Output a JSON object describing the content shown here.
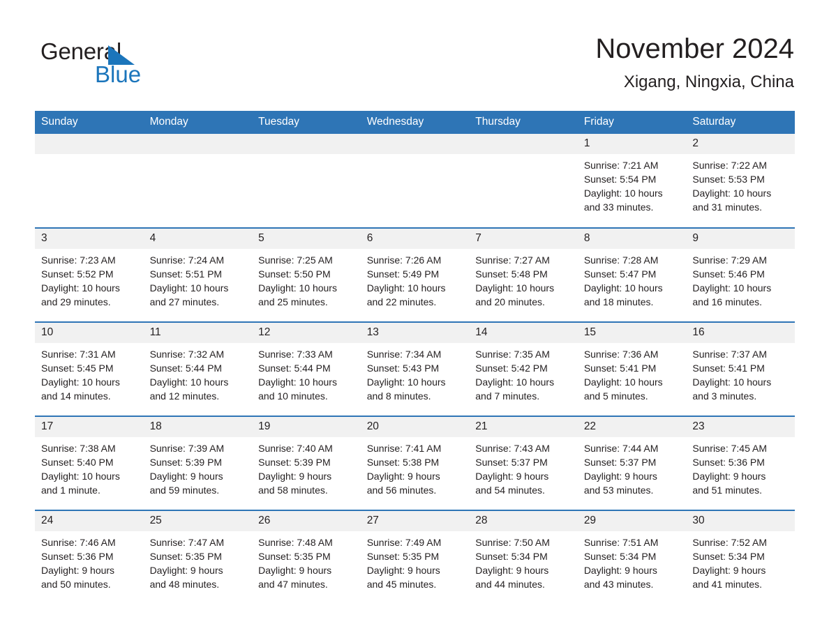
{
  "brand": {
    "name_part1": "General",
    "name_part2": "Blue",
    "triangle_icon": "triangle-icon",
    "accent_color": "#1b75bb"
  },
  "header": {
    "title": "November 2024",
    "location": "Xigang, Ningxia, China"
  },
  "theme": {
    "header_bg": "#2e75b6",
    "header_text": "#ffffff",
    "daynum_bg": "#f1f1f1",
    "body_text": "#231f20",
    "cell_border": "#2e75b6"
  },
  "calendar": {
    "weekday_headers": [
      "Sunday",
      "Monday",
      "Tuesday",
      "Wednesday",
      "Thursday",
      "Friday",
      "Saturday"
    ],
    "weeks": [
      [
        {
          "day": "",
          "info": "",
          "empty": true
        },
        {
          "day": "",
          "info": "",
          "empty": true
        },
        {
          "day": "",
          "info": "",
          "empty": true
        },
        {
          "day": "",
          "info": "",
          "empty": true
        },
        {
          "day": "",
          "info": "",
          "empty": true
        },
        {
          "day": "1",
          "info": "Sunrise: 7:21 AM\nSunset: 5:54 PM\nDaylight: 10 hours\nand 33 minutes.",
          "empty": false
        },
        {
          "day": "2",
          "info": "Sunrise: 7:22 AM\nSunset: 5:53 PM\nDaylight: 10 hours\nand 31 minutes.",
          "empty": false
        }
      ],
      [
        {
          "day": "3",
          "info": "Sunrise: 7:23 AM\nSunset: 5:52 PM\nDaylight: 10 hours\nand 29 minutes.",
          "empty": false
        },
        {
          "day": "4",
          "info": "Sunrise: 7:24 AM\nSunset: 5:51 PM\nDaylight: 10 hours\nand 27 minutes.",
          "empty": false
        },
        {
          "day": "5",
          "info": "Sunrise: 7:25 AM\nSunset: 5:50 PM\nDaylight: 10 hours\nand 25 minutes.",
          "empty": false
        },
        {
          "day": "6",
          "info": "Sunrise: 7:26 AM\nSunset: 5:49 PM\nDaylight: 10 hours\nand 22 minutes.",
          "empty": false
        },
        {
          "day": "7",
          "info": "Sunrise: 7:27 AM\nSunset: 5:48 PM\nDaylight: 10 hours\nand 20 minutes.",
          "empty": false
        },
        {
          "day": "8",
          "info": "Sunrise: 7:28 AM\nSunset: 5:47 PM\nDaylight: 10 hours\nand 18 minutes.",
          "empty": false
        },
        {
          "day": "9",
          "info": "Sunrise: 7:29 AM\nSunset: 5:46 PM\nDaylight: 10 hours\nand 16 minutes.",
          "empty": false
        }
      ],
      [
        {
          "day": "10",
          "info": "Sunrise: 7:31 AM\nSunset: 5:45 PM\nDaylight: 10 hours\nand 14 minutes.",
          "empty": false
        },
        {
          "day": "11",
          "info": "Sunrise: 7:32 AM\nSunset: 5:44 PM\nDaylight: 10 hours\nand 12 minutes.",
          "empty": false
        },
        {
          "day": "12",
          "info": "Sunrise: 7:33 AM\nSunset: 5:44 PM\nDaylight: 10 hours\nand 10 minutes.",
          "empty": false
        },
        {
          "day": "13",
          "info": "Sunrise: 7:34 AM\nSunset: 5:43 PM\nDaylight: 10 hours\nand 8 minutes.",
          "empty": false
        },
        {
          "day": "14",
          "info": "Sunrise: 7:35 AM\nSunset: 5:42 PM\nDaylight: 10 hours\nand 7 minutes.",
          "empty": false
        },
        {
          "day": "15",
          "info": "Sunrise: 7:36 AM\nSunset: 5:41 PM\nDaylight: 10 hours\nand 5 minutes.",
          "empty": false
        },
        {
          "day": "16",
          "info": "Sunrise: 7:37 AM\nSunset: 5:41 PM\nDaylight: 10 hours\nand 3 minutes.",
          "empty": false
        }
      ],
      [
        {
          "day": "17",
          "info": "Sunrise: 7:38 AM\nSunset: 5:40 PM\nDaylight: 10 hours\nand 1 minute.",
          "empty": false
        },
        {
          "day": "18",
          "info": "Sunrise: 7:39 AM\nSunset: 5:39 PM\nDaylight: 9 hours\nand 59 minutes.",
          "empty": false
        },
        {
          "day": "19",
          "info": "Sunrise: 7:40 AM\nSunset: 5:39 PM\nDaylight: 9 hours\nand 58 minutes.",
          "empty": false
        },
        {
          "day": "20",
          "info": "Sunrise: 7:41 AM\nSunset: 5:38 PM\nDaylight: 9 hours\nand 56 minutes.",
          "empty": false
        },
        {
          "day": "21",
          "info": "Sunrise: 7:43 AM\nSunset: 5:37 PM\nDaylight: 9 hours\nand 54 minutes.",
          "empty": false
        },
        {
          "day": "22",
          "info": "Sunrise: 7:44 AM\nSunset: 5:37 PM\nDaylight: 9 hours\nand 53 minutes.",
          "empty": false
        },
        {
          "day": "23",
          "info": "Sunrise: 7:45 AM\nSunset: 5:36 PM\nDaylight: 9 hours\nand 51 minutes.",
          "empty": false
        }
      ],
      [
        {
          "day": "24",
          "info": "Sunrise: 7:46 AM\nSunset: 5:36 PM\nDaylight: 9 hours\nand 50 minutes.",
          "empty": false
        },
        {
          "day": "25",
          "info": "Sunrise: 7:47 AM\nSunset: 5:35 PM\nDaylight: 9 hours\nand 48 minutes.",
          "empty": false
        },
        {
          "day": "26",
          "info": "Sunrise: 7:48 AM\nSunset: 5:35 PM\nDaylight: 9 hours\nand 47 minutes.",
          "empty": false
        },
        {
          "day": "27",
          "info": "Sunrise: 7:49 AM\nSunset: 5:35 PM\nDaylight: 9 hours\nand 45 minutes.",
          "empty": false
        },
        {
          "day": "28",
          "info": "Sunrise: 7:50 AM\nSunset: 5:34 PM\nDaylight: 9 hours\nand 44 minutes.",
          "empty": false
        },
        {
          "day": "29",
          "info": "Sunrise: 7:51 AM\nSunset: 5:34 PM\nDaylight: 9 hours\nand 43 minutes.",
          "empty": false
        },
        {
          "day": "30",
          "info": "Sunrise: 7:52 AM\nSunset: 5:34 PM\nDaylight: 9 hours\nand 41 minutes.",
          "empty": false
        }
      ]
    ]
  }
}
